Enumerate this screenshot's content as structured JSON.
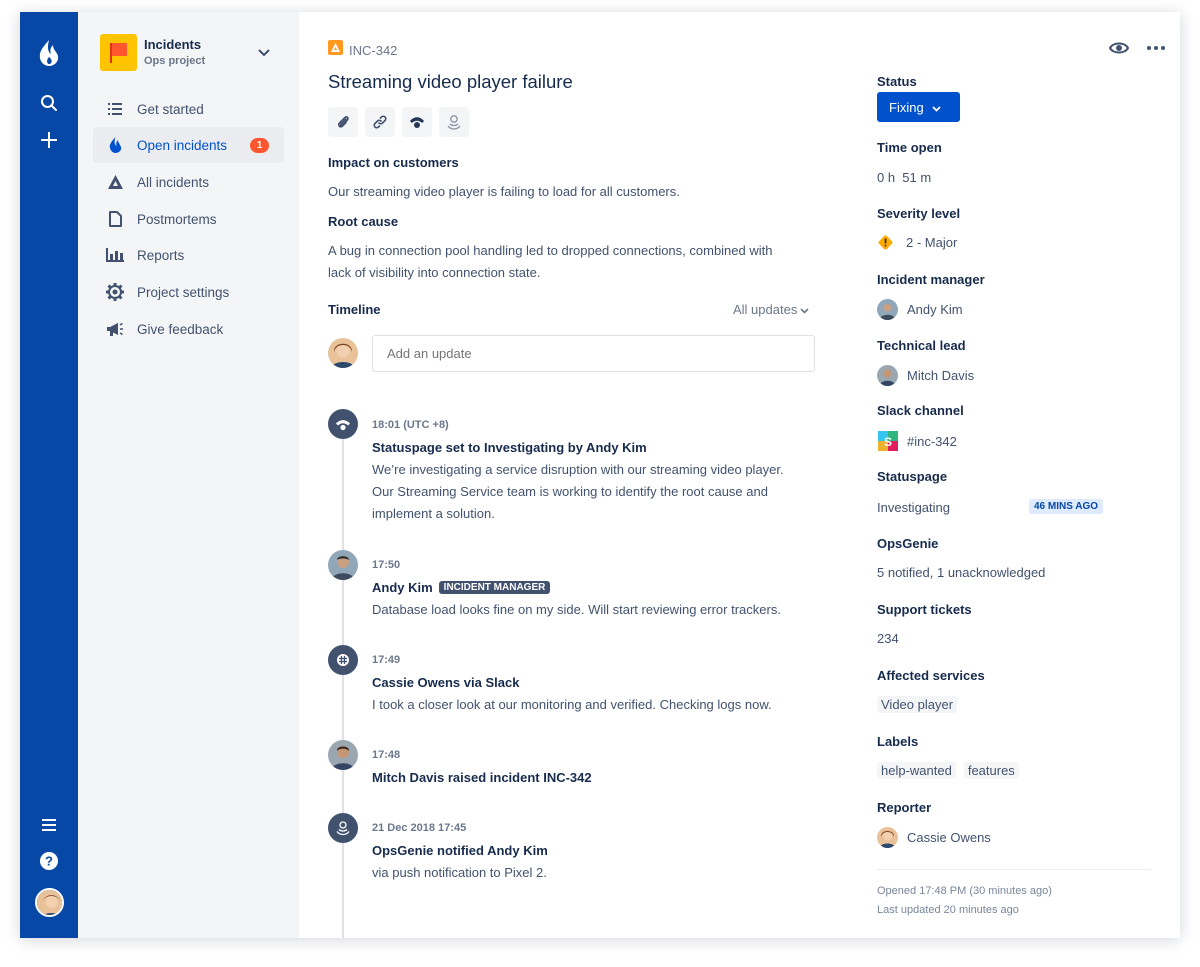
{
  "sidebar": {
    "project_name": "Incidents",
    "project_type": "Ops project",
    "items": [
      {
        "label": "Get started",
        "icon": "list-icon"
      },
      {
        "label": "Open incidents",
        "icon": "flame-icon",
        "badge": "1"
      },
      {
        "label": "All incidents",
        "icon": "triangle-icon"
      },
      {
        "label": "Postmortems",
        "icon": "document-icon"
      },
      {
        "label": "Reports",
        "icon": "bar-chart-icon"
      },
      {
        "label": "Project settings",
        "icon": "gear-icon"
      },
      {
        "label": "Give feedback",
        "icon": "megaphone-icon"
      }
    ]
  },
  "issue": {
    "key": "INC-342",
    "title": "Streaming video player failure",
    "impact_heading": "Impact on customers",
    "impact_text": "Our streaming video player is failing to load for all customers.",
    "root_cause_heading": "Root cause",
    "root_cause_line1": "A bug in connection pool handling led to dropped connections, combined with",
    "root_cause_line2": "lack of visibility into connection state."
  },
  "timeline": {
    "heading": "Timeline",
    "filter": "All updates",
    "placeholder": "Add an update",
    "events": [
      {
        "time": "18:01 (UTC +8)",
        "title": "Statuspage set to Investigating by Andy Kim",
        "lines": [
          "We’re investigating a service disruption with our streaming video player.",
          "Our Streaming Service team is working to identify the root cause and",
          "implement a solution."
        ]
      },
      {
        "time": "17:50",
        "title": "Andy Kim",
        "lozenge": "INCIDENT MANAGER",
        "lines": [
          "Database load looks fine on my side. Will start reviewing error trackers."
        ]
      },
      {
        "time": "17:49",
        "title": "Cassie Owens via Slack",
        "lines": [
          "I took a closer look at our monitoring and verified. Checking logs now."
        ]
      },
      {
        "time": "17:48",
        "title": "Mitch Davis raised incident INC-342",
        "lines": []
      },
      {
        "time": "21 Dec 2018 17:45",
        "title": "OpsGenie notified Andy Kim",
        "lines": [
          "via push notification to Pixel 2."
        ]
      }
    ]
  },
  "details": {
    "status_label": "Status",
    "status_value": "Fixing",
    "time_open_label": "Time open",
    "time_open_value": "0 h  51 m",
    "severity_label": "Severity level",
    "severity_value": "2 - Major",
    "manager_label": "Incident manager",
    "manager_value": "Andy Kim",
    "lead_label": "Technical lead",
    "lead_value": "Mitch Davis",
    "slack_label": "Slack channel",
    "slack_value": "#inc-342",
    "statuspage_label": "Statuspage",
    "statuspage_value": "Investigating",
    "statuspage_time": "46 MINS AGO",
    "opsgenie_label": "OpsGenie",
    "opsgenie_value": "5 notified, 1 unacknowledged",
    "tickets_label": "Support tickets",
    "tickets_value": "234",
    "services_label": "Affected services",
    "services": [
      "Video player"
    ],
    "labels_label": "Labels",
    "labels": [
      "help-wanted",
      "features"
    ],
    "reporter_label": "Reporter",
    "reporter_value": "Cassie Owens",
    "opened": "Opened 17:48 PM (30 minutes ago)",
    "updated": "Last updated 20 minutes ago"
  },
  "colors": {
    "nav": "#0747A6",
    "accent": "#0052CC",
    "badge": "#FF5630",
    "warning": "#FFAB00"
  }
}
